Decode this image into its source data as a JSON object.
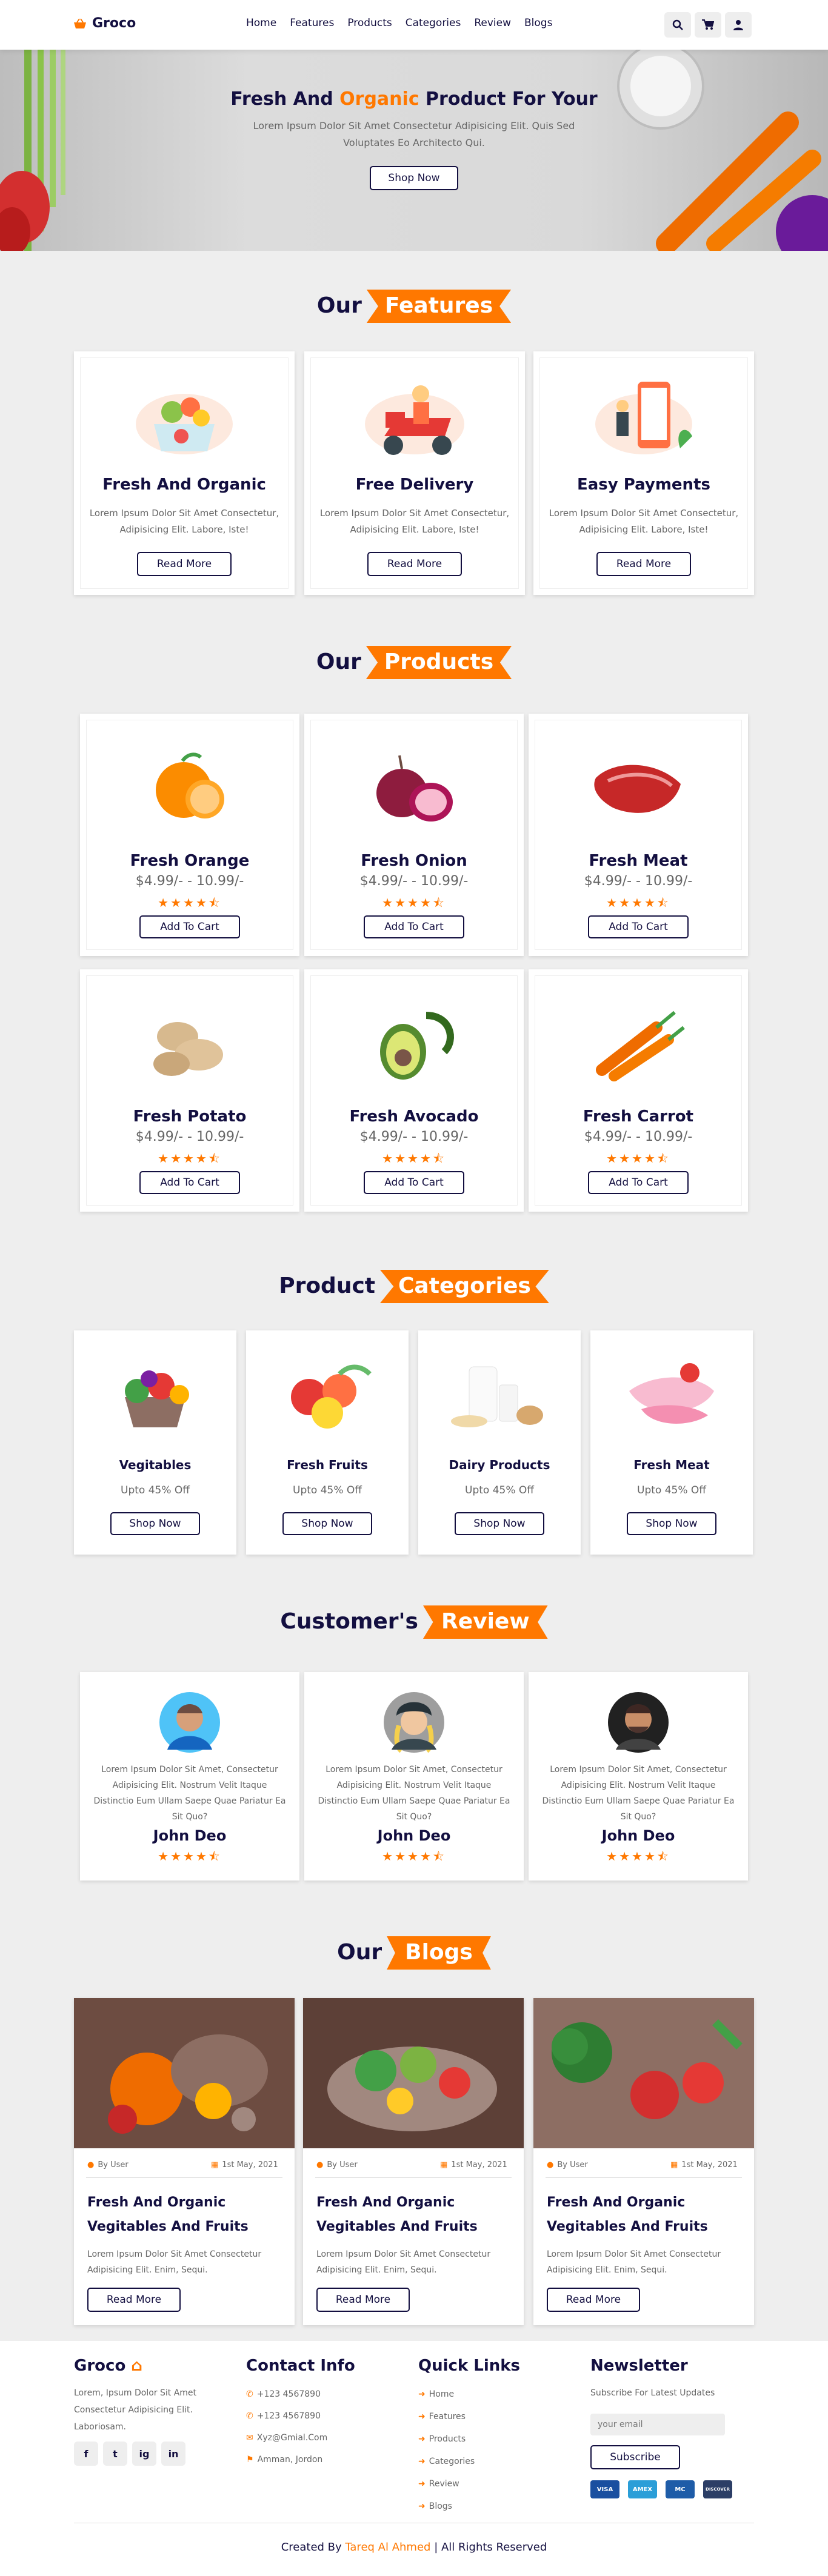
{
  "header": {
    "logo": "Groco",
    "nav": [
      "Home",
      "Features",
      "Products",
      "Categories",
      "Review",
      "Blogs"
    ],
    "icons": [
      "search-icon",
      "cart-icon",
      "user-icon"
    ]
  },
  "hero": {
    "title_before": "Fresh And ",
    "title_highlight": "Organic",
    "title_after": " Product For Your",
    "text": "Lorem Ipsum Dolor Sit Amet Consectetur Adipisicing Elit. Quis Sed Voluptates Eo Architecto Qui.",
    "button": "Shop Now"
  },
  "features": {
    "heading": "Our",
    "highlight": "Features",
    "items": [
      {
        "title": "Fresh And Organic",
        "desc": "Lorem Ipsum Dolor Sit Amet Consectetur, Adipisicing Elit. Labore, Iste!",
        "button": "Read More"
      },
      {
        "title": "Free Delivery",
        "desc": "Lorem Ipsum Dolor Sit Amet Consectetur, Adipisicing Elit. Labore, Iste!",
        "button": "Read More"
      },
      {
        "title": "Easy Payments",
        "desc": "Lorem Ipsum Dolor Sit Amet Consectetur, Adipisicing Elit. Labore, Iste!",
        "button": "Read More"
      }
    ]
  },
  "products": {
    "heading": "Our",
    "highlight": "Products",
    "items": [
      {
        "name": "Fresh Orange",
        "price": "$4.99/- - 10.99/-",
        "button": "Add To Cart",
        "rating": 4.5
      },
      {
        "name": "Fresh Onion",
        "price": "$4.99/- - 10.99/-",
        "button": "Add To Cart",
        "rating": 4.5
      },
      {
        "name": "Fresh Meat",
        "price": "$4.99/- - 10.99/-",
        "button": "Add To Cart",
        "rating": 4.5
      },
      {
        "name": "Fresh Potato",
        "price": "$4.99/- - 10.99/-",
        "button": "Add To Cart",
        "rating": 4.5
      },
      {
        "name": "Fresh Avocado",
        "price": "$4.99/- - 10.99/-",
        "button": "Add To Cart",
        "rating": 4.5
      },
      {
        "name": "Fresh Carrot",
        "price": "$4.99/- - 10.99/-",
        "button": "Add To Cart",
        "rating": 4.5
      }
    ]
  },
  "categories": {
    "heading": "Product",
    "highlight": "Categories",
    "items": [
      {
        "name": "Vegitables",
        "discount": "Upto 45% Off",
        "button": "Shop Now"
      },
      {
        "name": "Fresh Fruits",
        "discount": "Upto 45% Off",
        "button": "Shop Now"
      },
      {
        "name": "Dairy Products",
        "discount": "Upto 45% Off",
        "button": "Shop Now"
      },
      {
        "name": "Fresh Meat",
        "discount": "Upto 45% Off",
        "button": "Shop Now"
      }
    ]
  },
  "reviews": {
    "heading": "Customer's",
    "highlight": "Review",
    "items": [
      {
        "text": "Lorem Ipsum Dolor Sit Amet, Consectetur Adipisicing Elit. Nostrum Velit Itaque Distinctio Eum Ullam Saepe Quae Pariatur Ea Sit Quo?",
        "name": "John Deo",
        "rating": 4.5
      },
      {
        "text": "Lorem Ipsum Dolor Sit Amet, Consectetur Adipisicing Elit. Nostrum Velit Itaque Distinctio Eum Ullam Saepe Quae Pariatur Ea Sit Quo?",
        "name": "John Deo",
        "rating": 4.5
      },
      {
        "text": "Lorem Ipsum Dolor Sit Amet, Consectetur Adipisicing Elit. Nostrum Velit Itaque Distinctio Eum Ullam Saepe Quae Pariatur Ea Sit Quo?",
        "name": "John Deo",
        "rating": 4.5
      }
    ]
  },
  "blogs": {
    "heading": "Our",
    "highlight": "Blogs",
    "items": [
      {
        "author": "By User",
        "date": "1st May, 2021",
        "title": "Fresh And Organic Vegitables And Fruits",
        "desc": "Lorem Ipsum Dolor Sit Amet Consectetur Adipisicing Elit. Enim, Sequi.",
        "button": "Read More"
      },
      {
        "author": "By User",
        "date": "1st May, 2021",
        "title": "Fresh And Organic Vegitables And Fruits",
        "desc": "Lorem Ipsum Dolor Sit Amet Consectetur Adipisicing Elit. Enim, Sequi.",
        "button": "Read More"
      },
      {
        "author": "By User",
        "date": "1st May, 2021",
        "title": "Fresh And Organic Vegitables And Fruits",
        "desc": "Lorem Ipsum Dolor Sit Amet Consectetur Adipisicing Elit. Enim, Sequi.",
        "button": "Read More"
      }
    ]
  },
  "footer": {
    "brand": "Groco",
    "about": "Lorem, Ipsum Dolor Sit Amet Consectetur Adipisicing Elit. Laboriosam.",
    "social": [
      "f",
      "t",
      "ig",
      "in"
    ],
    "contact_title": "Contact Info",
    "contact": [
      "+123 4567890",
      "+123 4567890",
      "Xyz@Gmial.Com",
      "Amman, Jordon"
    ],
    "links_title": "Quick Links",
    "links": [
      "Home",
      "Features",
      "Products",
      "Categories",
      "Review",
      "Blogs"
    ],
    "newsletter_title": "Newsletter",
    "newsletter_text": "Subscribe For Latest Updates",
    "email_placeholder": "your email",
    "subscribe": "Subscribe",
    "payments": [
      "VISA",
      "AMEX",
      "MC",
      "DISCOVER"
    ],
    "credit_before": "Created By ",
    "credit_name": "Tareq Al Ahmed",
    "credit_after": " | All Rights Reserved"
  },
  "colors": {
    "accent": "#ff7800",
    "dark": "#130f40",
    "gray": "#666666",
    "bg": "#eeeeee"
  }
}
